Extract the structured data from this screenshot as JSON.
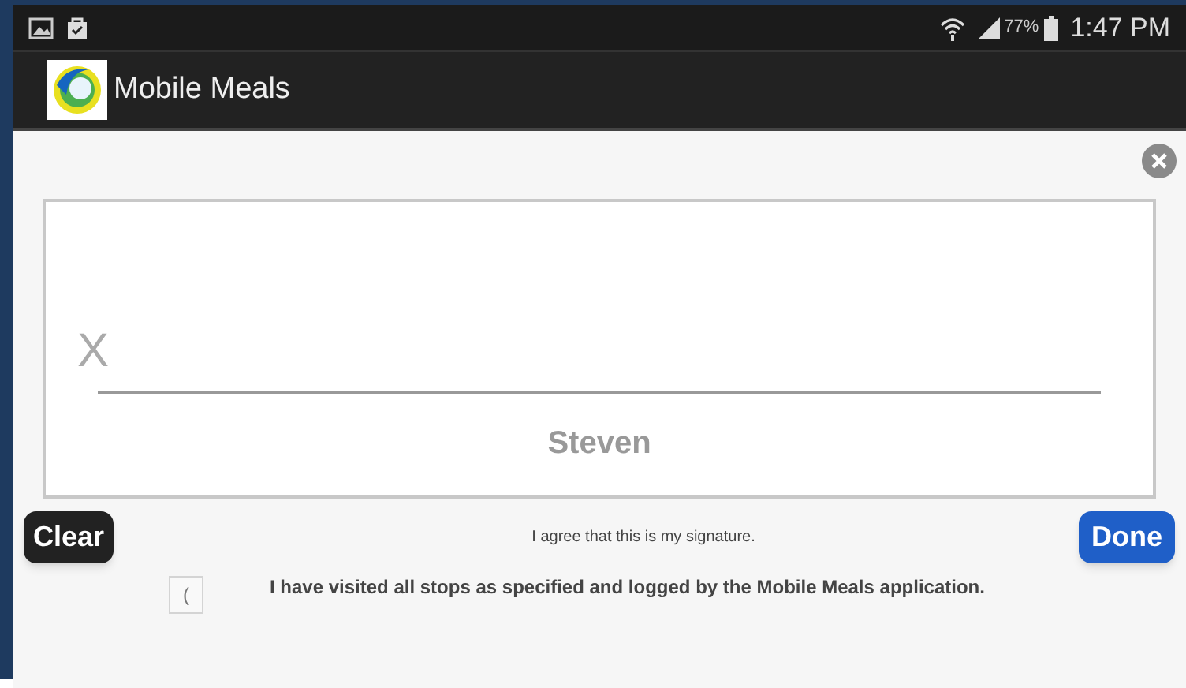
{
  "status_bar": {
    "battery": "77%",
    "time": "1:47 PM"
  },
  "app_bar": {
    "title": "Mobile Meals"
  },
  "signature": {
    "mark": "X",
    "name": "Steven"
  },
  "actions": {
    "clear": "Clear",
    "agreement": "I agree that this is my signature.",
    "done": "Done"
  },
  "confirmation": {
    "glyph": "(",
    "text": "I have visited all stops as specified and logged by the Mobile Meals application."
  }
}
